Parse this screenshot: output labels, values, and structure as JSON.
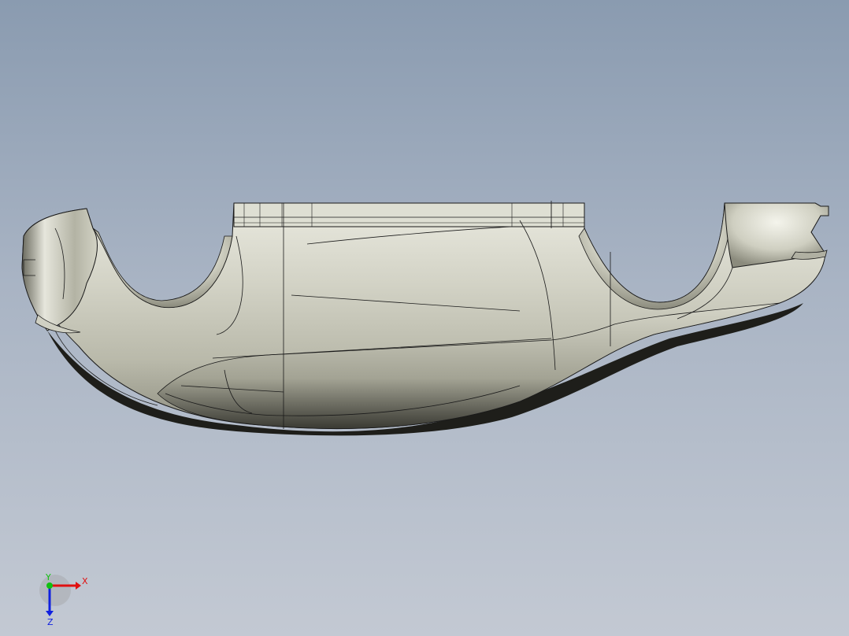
{
  "viewport": {
    "background_top": "#8a9bb0",
    "background_bottom": "#c3c9d3"
  },
  "model": {
    "name": "",
    "shade_light": "#efefe6",
    "shade_mid": "#c4c4b4",
    "shade_dark": "#2b2b26",
    "edge_color": "#1a1a1a"
  },
  "triad": {
    "x_label": "X",
    "y_label": "Y",
    "z_label": "Z",
    "x_color": "#e01010",
    "y_color": "#10c010",
    "z_color": "#1020e0"
  }
}
